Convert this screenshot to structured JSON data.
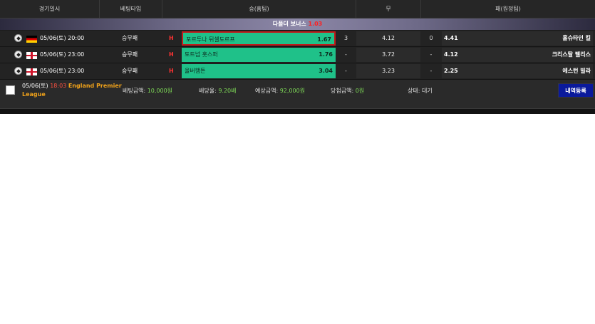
{
  "header": {
    "col_datetime": "경기일시",
    "col_type": "베팅타입",
    "col_home": "승(홈팀)",
    "col_draw": "무",
    "col_away": "패(원정팀)"
  },
  "bonus": {
    "label": "다폴더 보너스",
    "value": "1.03"
  },
  "rows": [
    {
      "flag": "germany-flag-icon",
      "datetime": "05/06(토) 20:00",
      "type": "승무패",
      "marker": "H",
      "home_team": "포르투나 뒤셀도르프",
      "home_odds": "1.67",
      "handicap": "3",
      "draw_odds": "4.12",
      "draw_line": "0",
      "away_odds": "4.41",
      "away_team": "홀슈타인 킬"
    },
    {
      "flag": "england-flag-icon",
      "datetime": "05/06(토) 23:00",
      "type": "승무패",
      "marker": "H",
      "home_team": "토트넘 홋스퍼",
      "home_odds": "1.76",
      "handicap": "-",
      "draw_odds": "3.72",
      "draw_line": "-",
      "away_odds": "4.12",
      "away_team": "크리스탈 팰리스"
    },
    {
      "flag": "england-flag-icon",
      "datetime": "05/06(토) 23:00",
      "type": "승무패",
      "marker": "H",
      "home_team": "울버햄튼",
      "home_odds": "3.04",
      "handicap": "-",
      "draw_odds": "3.23",
      "draw_line": "-",
      "away_odds": "2.25",
      "away_team": "에스턴 빌라"
    }
  ],
  "footer": {
    "date": "05/06(토)",
    "time": "18:03",
    "league": "England Premier League",
    "bet_amount_label": "베팅금액:",
    "bet_amount": "10,000원",
    "rate_label": "배당율:",
    "rate": "9.20배",
    "expected_label": "예상금액:",
    "expected": "92,000원",
    "win_label": "당첨금액:",
    "win": "0원",
    "status_label": "상태:",
    "status": "대기",
    "register_button": "내역등록"
  },
  "colors": {
    "home_selected_bg": "#1fc189",
    "selected_border": "#c01b1b",
    "bonus_value": "#ff2020",
    "league_text": "#f0a21a",
    "amount_text": "#7ed957",
    "register_button_bg": "#0a1a9c"
  }
}
